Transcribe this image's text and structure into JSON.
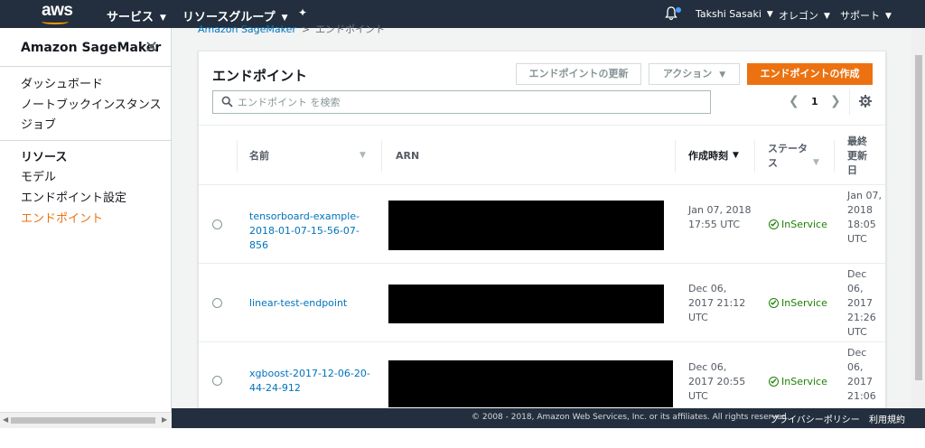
{
  "topnav": {
    "logo": "aws",
    "services": "サービス",
    "resource_groups": "リソースグループ",
    "user": "Takshi Sasaki",
    "region": "オレゴン",
    "support": "サポート"
  },
  "sidebar": {
    "title": "Amazon SageMaker",
    "items": [
      {
        "label": "ダッシュボード"
      },
      {
        "label": "ノートブックインスタンス"
      },
      {
        "label": "ジョブ"
      }
    ],
    "section_title": "リソース",
    "resource_items": [
      {
        "label": "モデル"
      },
      {
        "label": "エンドポイント設定"
      },
      {
        "label": "エンドポイント"
      }
    ]
  },
  "breadcrumb": {
    "root": "Amazon SageMaker",
    "current": "エンドポイント"
  },
  "panel": {
    "title": "エンドポイント",
    "update_button": "エンドポイントの更新",
    "action_button": "アクション",
    "create_button": "エンドポイントの作成",
    "search_placeholder": "エンドポイント を検索",
    "page_number": "1"
  },
  "table": {
    "columns": {
      "name": "名前",
      "arn": "ARN",
      "created": "作成時刻",
      "status": "ステータス",
      "updated": "最終更新日"
    },
    "rows": [
      {
        "name": "tensorboard-example-2018-01-07-15-56-07-856",
        "created": "Jan 07, 2018 17:55 UTC",
        "status": "InService",
        "updated": "Jan 07, 2018 18:05 UTC"
      },
      {
        "name": "linear-test-endpoint",
        "created": "Dec 06, 2017 21:12 UTC",
        "status": "InService",
        "updated": "Dec 06, 2017 21:26 UTC"
      },
      {
        "name": "xgboost-2017-12-06-20-44-24-912",
        "created": "Dec 06, 2017 20:55 UTC",
        "status": "InService",
        "updated": "Dec 06, 2017 21:06"
      }
    ]
  },
  "footer": {
    "copyright": "© 2008 - 2018, Amazon Web Services, Inc. or its affiliates. All rights reserved.",
    "privacy": "プライバシーポリシー",
    "terms": "利用規約"
  },
  "colors": {
    "nav_bg": "#232f3e",
    "accent": "#ec7211",
    "link": "#0073bb",
    "success": "#1d8102"
  }
}
